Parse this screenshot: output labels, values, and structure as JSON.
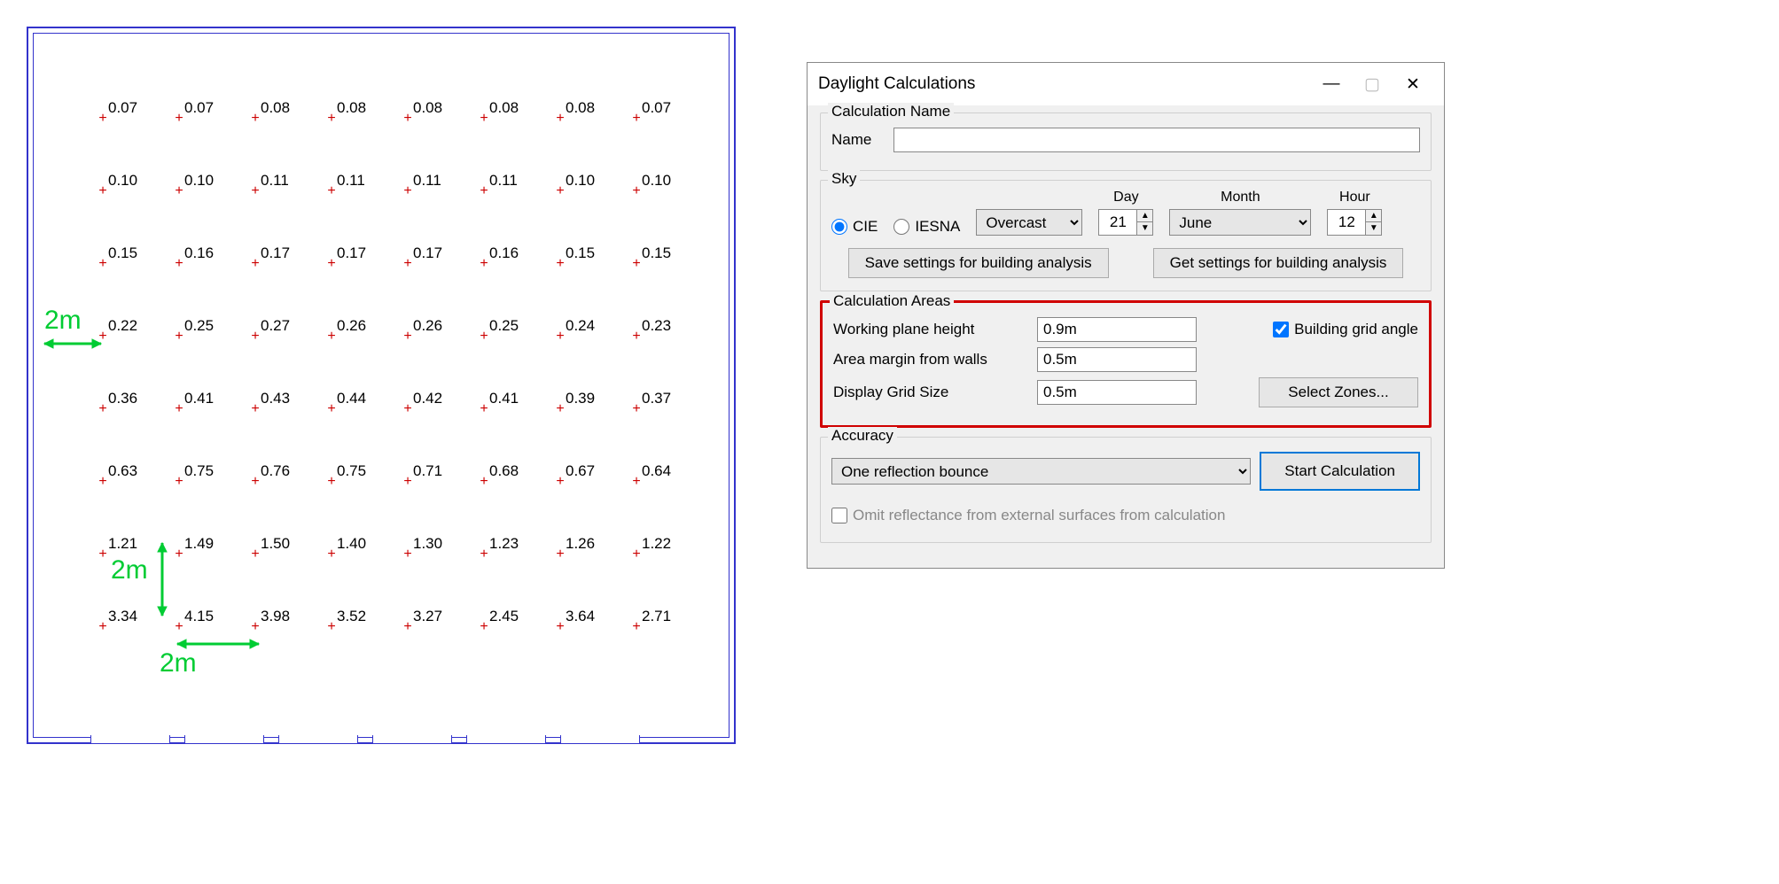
{
  "plan": {
    "grid_rows": [
      [
        "0.07",
        "0.07",
        "0.08",
        "0.08",
        "0.08",
        "0.08",
        "0.08",
        "0.07"
      ],
      [
        "0.10",
        "0.10",
        "0.11",
        "0.11",
        "0.11",
        "0.11",
        "0.10",
        "0.10"
      ],
      [
        "0.15",
        "0.16",
        "0.17",
        "0.17",
        "0.17",
        "0.16",
        "0.15",
        "0.15"
      ],
      [
        "0.22",
        "0.25",
        "0.27",
        "0.26",
        "0.26",
        "0.25",
        "0.24",
        "0.23"
      ],
      [
        "0.36",
        "0.41",
        "0.43",
        "0.44",
        "0.42",
        "0.41",
        "0.39",
        "0.37"
      ],
      [
        "0.63",
        "0.75",
        "0.76",
        "0.75",
        "0.71",
        "0.68",
        "0.67",
        "0.64"
      ],
      [
        "1.21",
        "1.49",
        "1.50",
        "1.40",
        "1.30",
        "1.23",
        "1.26",
        "1.22"
      ],
      [
        "3.34",
        "4.15",
        "3.98",
        "3.52",
        "3.27",
        "2.45",
        "3.64",
        "2.71"
      ]
    ],
    "annotations": {
      "left": "2m",
      "vert": "2m",
      "horiz": "2m"
    }
  },
  "dialog": {
    "title": "Daylight Calculations",
    "calc_name": {
      "group": "Calculation Name",
      "label": "Name",
      "value": ""
    },
    "sky": {
      "group": "Sky",
      "radio_cie": "CIE",
      "radio_iesna": "IESNA",
      "selected_radio": "CIE",
      "type": "Overcast",
      "day_label": "Day",
      "day": "21",
      "month_label": "Month",
      "month": "June",
      "hour_label": "Hour",
      "hour": "12",
      "save_btn": "Save settings for building analysis",
      "get_btn": "Get settings for building analysis"
    },
    "calc_areas": {
      "group": "Calculation Areas",
      "wph_label": "Working plane height",
      "wph": "0.9m",
      "margin_label": "Area margin from walls",
      "margin": "0.5m",
      "grid_label": "Display Grid Size",
      "grid": "0.5m",
      "angle_label": "Building grid angle",
      "angle_checked": true,
      "zones_btn": "Select Zones..."
    },
    "accuracy": {
      "group": "Accuracy",
      "mode": "One reflection bounce",
      "start_btn": "Start Calculation",
      "omit_label": "Omit reflectance from external surfaces from calculation",
      "omit_checked": false
    }
  }
}
